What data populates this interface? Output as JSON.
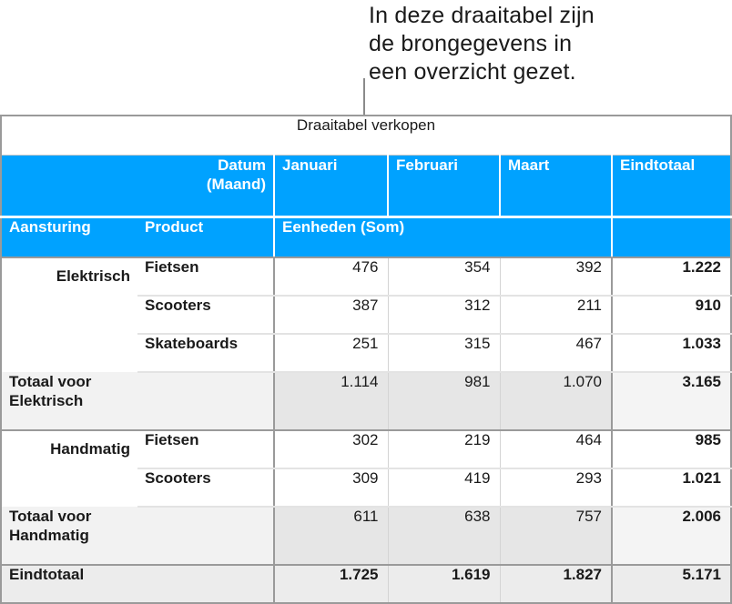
{
  "callout": {
    "text": "In deze draaitabel zijn\nde brongegevens in\neen overzicht gezet."
  },
  "table": {
    "title": "Draaitabel verkopen",
    "header": {
      "column_field_label": "Datum (Maand)",
      "columns": [
        "Januari",
        "Februari",
        "Maart",
        "Eindtotaal"
      ],
      "row_field_1": "Aansturing",
      "row_field_2": "Product",
      "value_label": "Eenheden (Som)"
    },
    "colors": {
      "header_bg": "#00a2ff",
      "header_text": "#ffffff",
      "subtotal_bg": "#e6e6e6",
      "grand_total_bg": "#ececec"
    },
    "groups": [
      {
        "name": "Elektrisch",
        "rows": [
          {
            "product": "Fietsen",
            "values": [
              "476",
              "354",
              "392"
            ],
            "total": "1.222"
          },
          {
            "product": "Scooters",
            "values": [
              "387",
              "312",
              "211"
            ],
            "total": "910"
          },
          {
            "product": "Skateboards",
            "values": [
              "251",
              "315",
              "467"
            ],
            "total": "1.033"
          }
        ],
        "subtotal_label": "Totaal voor Elektrisch",
        "subtotal_values": [
          "1.114",
          "981",
          "1.070"
        ],
        "subtotal_total": "3.165"
      },
      {
        "name": "Handmatig",
        "rows": [
          {
            "product": "Fietsen",
            "values": [
              "302",
              "219",
              "464"
            ],
            "total": "985"
          },
          {
            "product": "Scooters",
            "values": [
              "309",
              "419",
              "293"
            ],
            "total": "1.021"
          }
        ],
        "subtotal_label": "Totaal voor Handmatig",
        "subtotal_values": [
          "611",
          "638",
          "757"
        ],
        "subtotal_total": "2.006"
      }
    ],
    "grand_total": {
      "label": "Eindtotaal",
      "values": [
        "1.725",
        "1.619",
        "1.827"
      ],
      "total": "5.171"
    }
  }
}
